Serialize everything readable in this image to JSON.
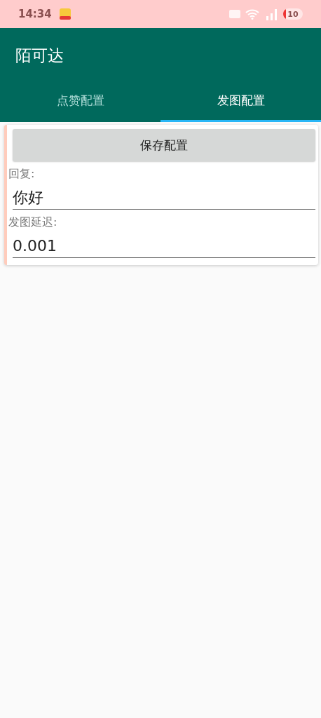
{
  "status_bar": {
    "time": "14:34",
    "battery": "10"
  },
  "app_bar": {
    "title": "陌可达"
  },
  "tabs": [
    {
      "label": "点赞配置",
      "selected": false
    },
    {
      "label": "发图配置",
      "selected": true
    }
  ],
  "save_button": "保存配置",
  "fields": [
    {
      "label": "回复:",
      "value": "你好"
    },
    {
      "label": "发图延迟:",
      "value": "0.001"
    }
  ]
}
